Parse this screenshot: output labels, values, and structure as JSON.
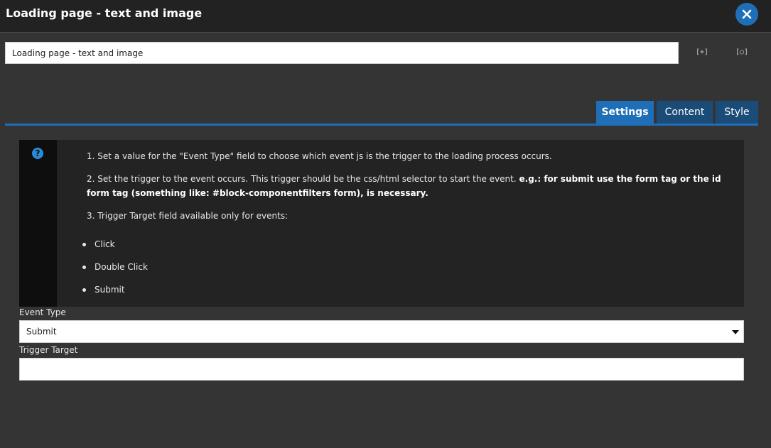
{
  "window": {
    "title": "Loading page - text and image"
  },
  "name_field": {
    "value": "Loading page - text and image"
  },
  "toolbar": {
    "expand_label": "[+]",
    "preview_label": "[○]"
  },
  "tabs": [
    {
      "label": "Settings",
      "active": true
    },
    {
      "label": "Content",
      "active": false
    },
    {
      "label": "Style",
      "active": false
    }
  ],
  "help": {
    "icon": "question-circle-icon",
    "step1": "1. Set a value for the \"Event Type\" field to choose which event js is the trigger to the loading process occurs.",
    "step2_text": "2. Set the trigger to the event occurs. This trigger should be the css/html selector to start the event.",
    "step2_bold": "e.g.: for submit use the form tag or the id form tag (something like: #block-componentfilters form), is necessary.",
    "step3": "3. Trigger Target field available only for events:",
    "events": [
      "Click",
      "Double Click",
      "Submit"
    ]
  },
  "event_type": {
    "label": "Event Type",
    "value": "Submit"
  },
  "trigger_target": {
    "label": "Trigger Target",
    "value": ""
  },
  "colors": {
    "accent": "#1f6fb8",
    "background": "#343434",
    "titlebar": "#222222"
  }
}
